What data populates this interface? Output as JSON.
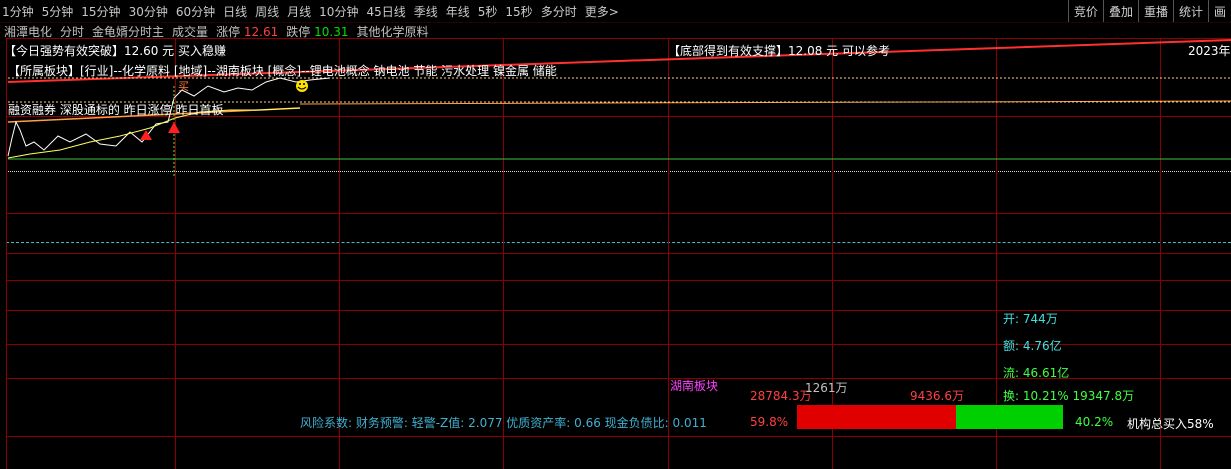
{
  "toolbar": {
    "periods": [
      "1分钟",
      "5分钟",
      "15分钟",
      "30分钟",
      "60分钟",
      "日线",
      "周线",
      "月线",
      "10分钟",
      "45日线",
      "季线",
      "年线",
      "5秒",
      "15秒",
      "多分时",
      "更多>"
    ],
    "right_buttons": [
      "竞价",
      "叠加",
      "重播",
      "统计",
      "画"
    ]
  },
  "info": {
    "stock_name": "湘潭电化",
    "view": "分时",
    "indicator": "金龟婿分时主",
    "volume": "成交量",
    "limit_up_label": "涨停",
    "limit_up_value": "12.61",
    "limit_down_label": "跌停",
    "limit_down_value": "10.31",
    "industry": "其他化学原料"
  },
  "annotations": {
    "breakout": "【今日强势有效突破】12.60 元 买入稳赚",
    "sector": "【所属板块】[行业]--化学原料 [地域]--湖南板块 [概念]--锂电池概念 钠电池 节能 污水处理 镍金属 储能",
    "margin": "融资融券 深股通标的 昨日涨停 昨日首板",
    "support": "【底部得到有效支撑】12.08 元 可以参考",
    "year": "2023年",
    "buy_mark": "买"
  },
  "stats": {
    "open_label": "开:",
    "open_value": "744万",
    "amount_label": "额:",
    "amount_value": "4.76亿",
    "float_label": "流:",
    "float_value": "46.61亿",
    "turnover_label": "换:",
    "turnover_value": "10.21%",
    "turnover_amount": "19347.8万"
  },
  "flow": {
    "sector_label": "湖南板块",
    "inflow_value": "28784.3万",
    "middle_value": "1261万",
    "outflow_value": "9436.6万",
    "inflow_pct": "59.8%",
    "outflow_pct": "40.2%",
    "inflow_ratio": 0.598,
    "institution": "机构总买入58%"
  },
  "risk": {
    "text": "风险系数: 财务预警: 轻警-Z值: 2.077 优质资产率: 0.66 现金负债比: 0.011"
  },
  "colors": {
    "grid": "#8a0000",
    "up": "#ff4040",
    "down": "#00e000",
    "bar_red": "#e00000",
    "bar_green": "#00d000"
  }
}
